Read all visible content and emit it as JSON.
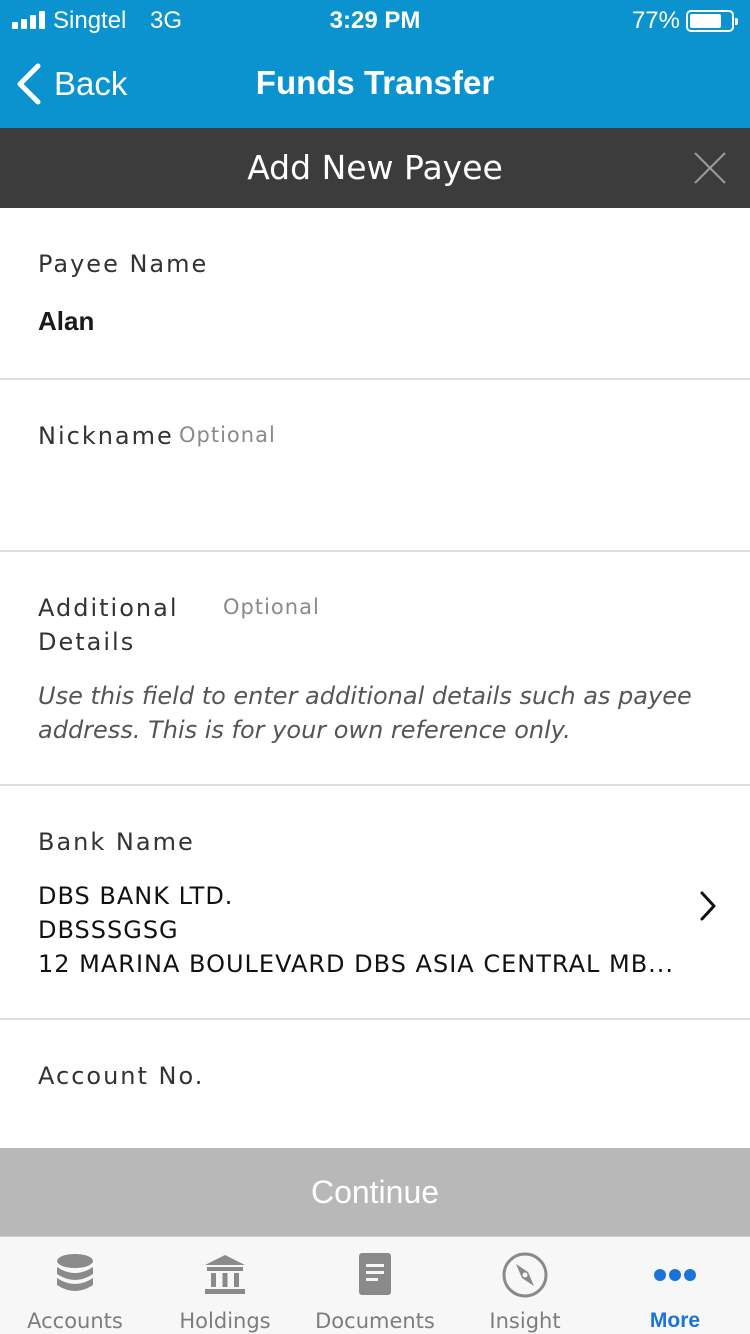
{
  "status_bar": {
    "carrier": "Singtel",
    "network": "3G",
    "time": "3:29 PM",
    "battery_percent": "77%",
    "battery_level": 0.77
  },
  "nav": {
    "back_label": "Back",
    "title": "Funds Transfer"
  },
  "modal": {
    "title": "Add New Payee"
  },
  "form": {
    "payee_name": {
      "label": "Payee Name",
      "value": "Alan"
    },
    "nickname": {
      "label": "Nickname",
      "optional": "Optional",
      "value": ""
    },
    "additional_details": {
      "label_line1": "Additional",
      "label_line2": "Details",
      "optional": "Optional",
      "hint_line1": "Use this field to enter additional details such as payee",
      "hint_line2": "address. This is for your own reference only."
    },
    "bank_name": {
      "label": "Bank Name",
      "line1": "DBS BANK LTD.",
      "line2": "DBSSSGSG",
      "line3": "12 MARINA BOULEVARD DBS ASIA CENTRAL MB..."
    },
    "account_no": {
      "label": "Account No.",
      "value": ""
    }
  },
  "continue_label": "Continue",
  "colors": {
    "brand_blue": "#0b93d0",
    "modal_header": "#3c3c3c",
    "disabled_button": "#b8b8b8",
    "active_tab": "#1a73d9"
  },
  "tabs": [
    {
      "label": "Accounts",
      "icon": "database-icon",
      "active": false
    },
    {
      "label": "Holdings",
      "icon": "bank-building-icon",
      "active": false
    },
    {
      "label": "Documents",
      "icon": "document-icon",
      "active": false
    },
    {
      "label": "Insight",
      "icon": "compass-icon",
      "active": false
    },
    {
      "label": "More",
      "icon": "more-dots-icon",
      "active": true
    }
  ]
}
